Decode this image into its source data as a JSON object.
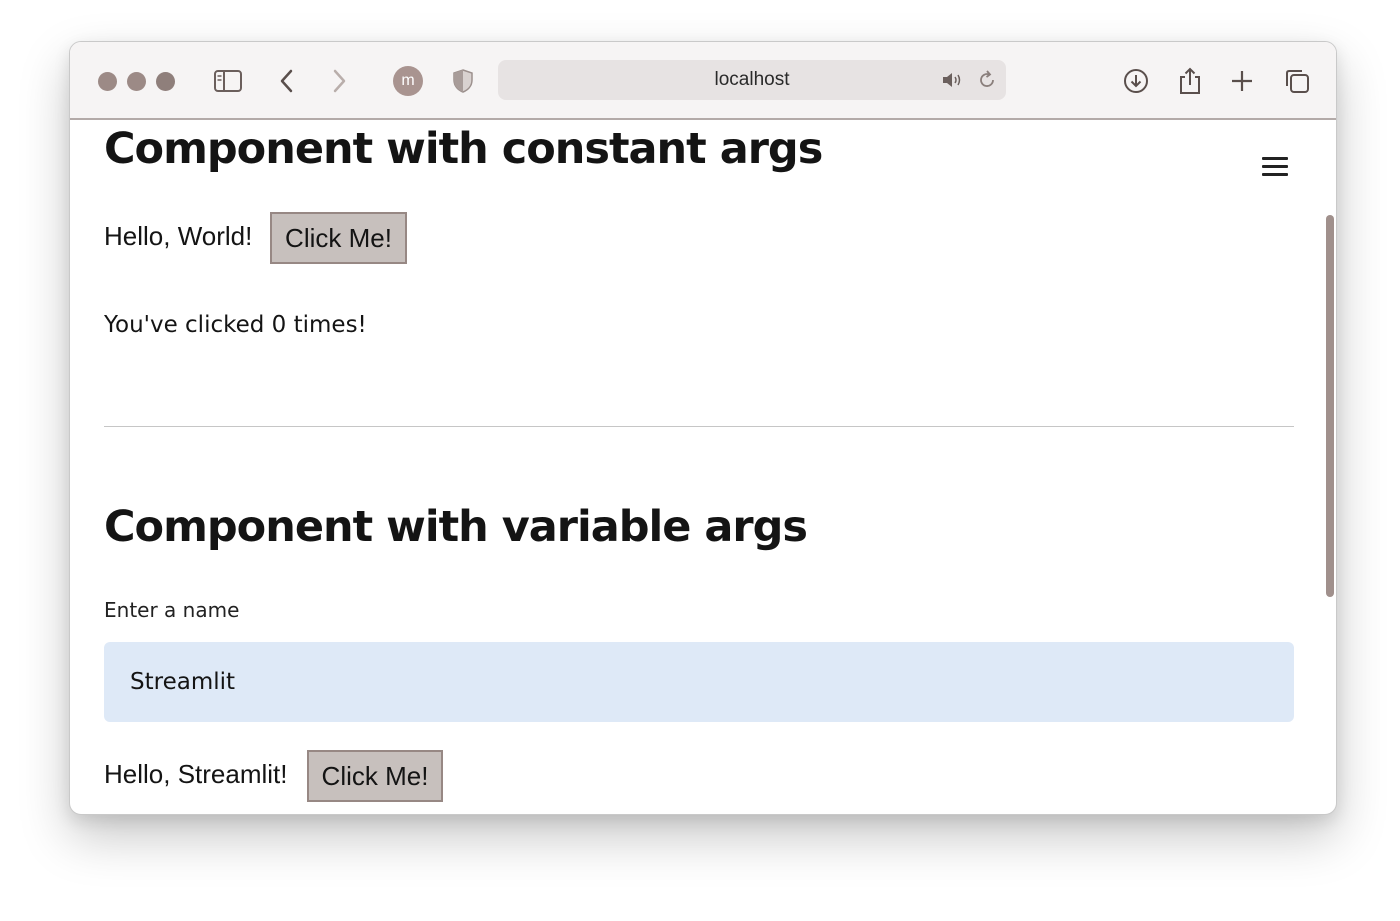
{
  "browser": {
    "address": "localhost",
    "avatar_letter": "m"
  },
  "section1": {
    "title": "Component with constant args",
    "greeting": "Hello, World!",
    "button_label": "Click Me!",
    "counter_text": "You've clicked 0 times!"
  },
  "section2": {
    "title": "Component with variable args",
    "input_label": "Enter a name",
    "input_value": "Streamlit",
    "greeting": "Hello, Streamlit!",
    "button_label": "Click Me!"
  },
  "icons": [
    "sidebar-icon",
    "back-icon",
    "forward-icon",
    "shield-icon",
    "speaker-icon",
    "reload-icon",
    "download-icon",
    "share-icon",
    "plus-icon",
    "tabs-icon",
    "hamburger-menu-icon"
  ],
  "colors": {
    "input_background": "#dee9f7",
    "button_background": "#c7c0bd",
    "scrollbar_thumb": "#a0908c"
  }
}
